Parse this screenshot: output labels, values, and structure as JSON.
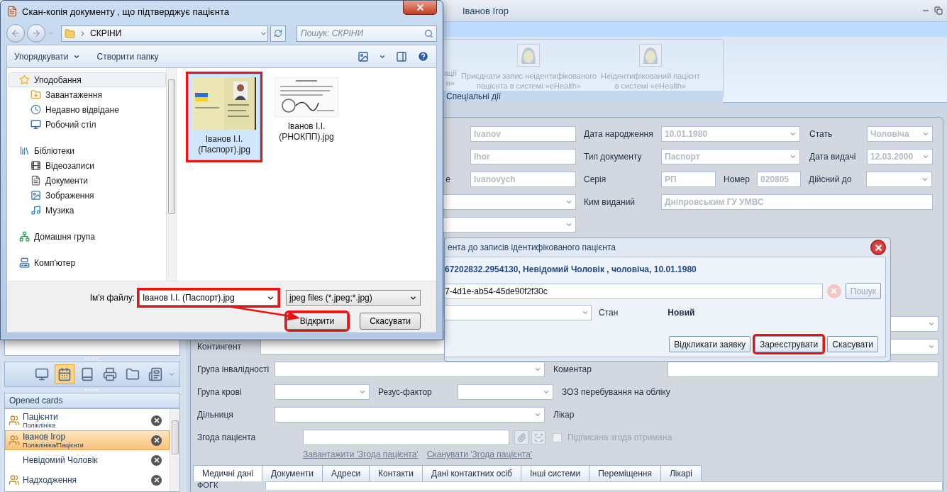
{
  "app": {
    "title": "Іванов Ігор"
  },
  "ribbon": {
    "group": "Спеціальні дії",
    "items": [
      {
        "kind": "partial",
        "label": "ації\nн»",
        "disabled": true
      },
      {
        "kind": "action",
        "label": "Приєднати запис неідентифікованого\nпацієнта в системі «eHealth»",
        "disabled": true
      },
      {
        "kind": "action",
        "label": "Неідентифікований пацієнт\nв системі «eHealth»",
        "disabled": true
      }
    ]
  },
  "sidebar": {
    "tools": [
      {
        "selected": false
      },
      {
        "selected": true
      },
      {
        "selected": false
      },
      {
        "selected": false
      },
      {
        "selected": false
      },
      {
        "selected": false
      }
    ],
    "opened_cards": {
      "title": "Opened cards",
      "items": [
        {
          "kind": "group",
          "name": "Пацієнти",
          "path": "Поліклініка",
          "selected": false
        },
        {
          "kind": "group",
          "name": "Іванов Ігор",
          "path": "Поліклініка/Пацієнти",
          "selected": true
        },
        {
          "kind": "card",
          "name": "Невідомий Чоловік",
          "selected": false
        },
        {
          "kind": "group",
          "name": "Надходження",
          "selected": false
        }
      ]
    }
  },
  "form": {
    "person": {
      "disabled": true,
      "last_name": "Ivanov",
      "first_name": "Ihor",
      "middle_name_label": "е",
      "middle_name": "Ivanovych",
      "birth_date": {
        "label": "Дата народження",
        "value": "10.01.1980"
      },
      "sex": {
        "label": "Стать",
        "value": "Чоловіча"
      },
      "document_type": {
        "label": "Тип документу",
        "value": "Паспорт"
      },
      "issue_date": {
        "label": "Дата видачі",
        "value": "12.03.2000"
      },
      "series": {
        "label": "Серія",
        "value": "РП"
      },
      "number": {
        "label": "Номер",
        "value": "020805"
      },
      "valid_until": {
        "label": "Дійсний до"
      },
      "issued_by": {
        "label": "Ким виданий",
        "value": "Дніпровським ГУ УМВС"
      }
    },
    "contingent": {
      "label": "Контингент"
    },
    "disability_group": {
      "label": "Група інвалідності"
    },
    "comment": {
      "label": "Коментар"
    },
    "blood_group": {
      "label": "Група крові"
    },
    "rh_factor": {
      "label": "Резус-фактор"
    },
    "registration_facility": {
      "label": "ЗОЗ перебування на обліку"
    },
    "district": {
      "label": "Дільниця"
    },
    "doctor": {
      "label": "Лікар"
    },
    "consent": {
      "label": "Згода пацієнта",
      "signed_label": "Підписана згода отримана",
      "signed": false,
      "signed_disabled": true,
      "links": [
        "Завантажити 'Згода пацієнта'",
        "Сканувати 'Згода пацієнта'"
      ]
    },
    "tabs": [
      {
        "label": "Медичні дані",
        "selected": true
      },
      {
        "label": "Документи",
        "selected": false
      },
      {
        "label": "Адреси",
        "selected": false
      },
      {
        "label": "Контакти",
        "selected": false
      },
      {
        "label": "Дані контактних осіб",
        "selected": false
      },
      {
        "label": "Інші системи",
        "selected": false
      },
      {
        "label": "Переміщення",
        "selected": false
      },
      {
        "label": "Лікарі",
        "selected": false
      }
    ],
    "fogk_label": "ФОГК"
  },
  "modal": {
    "title": "ента до записів ідентифікованого пацієнта",
    "info": "67202832.2954130, Невідомий Чоловік , чоловіча, 10.01.1980",
    "search_value": "7-4d1e-ab54-45de90f2f30c",
    "search_button": {
      "label": "Пошук",
      "disabled": true
    },
    "status_label": "Стан",
    "status": "Новий",
    "buttons": [
      {
        "label": "Відкликати заявку",
        "highlighted": false
      },
      {
        "label": "Зареєструвати",
        "highlighted": true
      },
      {
        "label": "Скасувати",
        "highlighted": false
      }
    ]
  },
  "file_dialog": {
    "title": "Скан-копія документу , що підтверджує пацієнта",
    "address": "СКРІНИ",
    "search_placeholder": "Пошук: СКРІНИ",
    "organize": "Упорядкувати",
    "new_folder": "Створити папку",
    "nav": [
      {
        "label": "Уподобання",
        "selected": true,
        "children": [
          {
            "label": "Завантаження",
            "selected": false
          },
          {
            "label": "Недавно відвідане",
            "selected": false
          },
          {
            "label": "Робочий стіл",
            "selected": false
          }
        ]
      },
      {
        "label": "Бібліотеки",
        "selected": false,
        "children": [
          {
            "label": "Відеозаписи",
            "selected": false
          },
          {
            "label": "Документи",
            "selected": false
          },
          {
            "label": "Зображення",
            "selected": false
          },
          {
            "label": "Музика",
            "selected": false
          }
        ]
      },
      {
        "label": "Домашня група",
        "selected": false
      },
      {
        "label": "Комп'ютер",
        "selected": false
      }
    ],
    "files": [
      {
        "kind": "passport",
        "name": "Іванов І.І. (Паспорт).jpg",
        "selected": true,
        "highlighted": true
      },
      {
        "kind": "document",
        "name": "Іванов І.І. (РНОКПП).jpg",
        "selected": false,
        "highlighted": false
      }
    ],
    "file_name_label": "Ім'я файлу:",
    "file_name": {
      "value": "Іванов І.І. (Паспорт).jpg",
      "highlighted": true
    },
    "file_type": "jpeg files (*.jpeg;*.jpg)",
    "buttons": [
      {
        "label": "Відкрити",
        "highlighted": true
      },
      {
        "label": "Скасувати",
        "highlighted": false
      }
    ]
  }
}
